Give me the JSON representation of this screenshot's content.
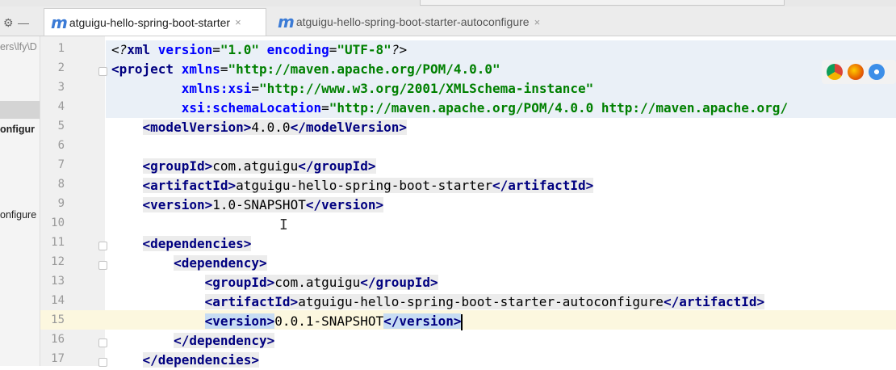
{
  "window": {
    "controls": [
      "⚙",
      "—"
    ]
  },
  "tabs": [
    {
      "label": "atguigu-hello-spring-boot-starter",
      "active": true,
      "close": "×"
    },
    {
      "label": "atguigu-hello-spring-boot-starter-autoconfigure",
      "active": false,
      "close": "×"
    }
  ],
  "left_panel": {
    "items": [
      "ers\\lfy\\D",
      "onfigur",
      "onfigure"
    ]
  },
  "editor": {
    "line_numbers": [
      "1",
      "2",
      "3",
      "4",
      "5",
      "6",
      "7",
      "8",
      "9",
      "10",
      "11",
      "12",
      "13",
      "14",
      "15",
      "16",
      "17"
    ],
    "current_line": 15
  },
  "browsers": [
    "chrome-icon",
    "firefox-icon",
    "safari-icon"
  ],
  "colors": {
    "tag": "#000080",
    "attribute": "#0000ff",
    "string": "#008000",
    "current_line": "#fcf7df",
    "selection": "#c7dcf3"
  }
}
